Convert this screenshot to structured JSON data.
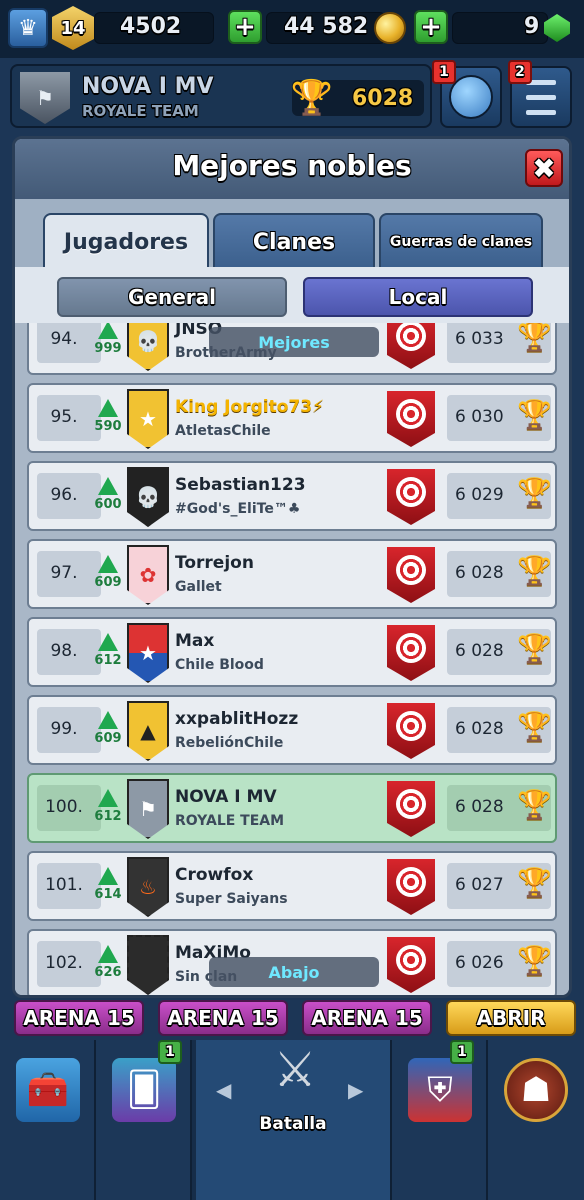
{
  "topbar": {
    "level": "14",
    "trophy_count": "4502",
    "gold": "44 582",
    "gems": "9",
    "icons": [
      "crown-icon",
      "level-badge-icon",
      "plus-icon",
      "gold-coin-icon",
      "gem-icon"
    ]
  },
  "profile": {
    "name": "NOVA I MV",
    "clan": "ROYALE TEAM",
    "trophies": "6028",
    "social_notif": "1",
    "menu_notif": "2"
  },
  "modal": {
    "title": "Mejores nobles",
    "tabs": [
      "Jugadores",
      "Clanes",
      "Guerras de clanes"
    ],
    "subtabs": [
      "General",
      "Local"
    ],
    "overlay_top": "Mejores",
    "overlay_bottom": "Abajo"
  },
  "rows": [
    {
      "rank": "94.",
      "change": "999",
      "name": "JNSO",
      "clan": "BrotherArmy",
      "trophies": "6 033"
    },
    {
      "rank": "95.",
      "change": "590",
      "name": "King Jorgito73⚡",
      "clan": "AtletasChile",
      "trophies": "6 030"
    },
    {
      "rank": "96.",
      "change": "600",
      "name": "Sebastian123",
      "clan": "#God's_EliTe™♣",
      "trophies": "6 029"
    },
    {
      "rank": "97.",
      "change": "609",
      "name": "Torrejon",
      "clan": "Gallet",
      "trophies": "6 028"
    },
    {
      "rank": "98.",
      "change": "612",
      "name": "Max",
      "clan": "Chile Blood",
      "trophies": "6 028"
    },
    {
      "rank": "99.",
      "change": "609",
      "name": "xxpablitHozz",
      "clan": "RebeliónChile",
      "trophies": "6 028"
    },
    {
      "rank": "100.",
      "change": "612",
      "name": "NOVA I MV",
      "clan": "ROYALE TEAM",
      "trophies": "6 028"
    },
    {
      "rank": "101.",
      "change": "614",
      "name": "Crowfox",
      "clan": "Super Saiyans",
      "trophies": "6 027"
    },
    {
      "rank": "102.",
      "change": "626",
      "name": "MaXiMo",
      "clan": "Sin clan",
      "trophies": "6 026"
    }
  ],
  "arena_strip": [
    "ARENA 15",
    "ARENA 15",
    "ARENA 15",
    "ABRIR"
  ],
  "bottomnav": {
    "battle_label": "Batalla",
    "cards_notif": "1",
    "clan_notif": "1"
  },
  "colors": {
    "accent_green": "#20a84f",
    "highlight_row": "#b9e3c6",
    "trophy_gold": "#f2b524",
    "local_tab": "#5a63c0"
  }
}
